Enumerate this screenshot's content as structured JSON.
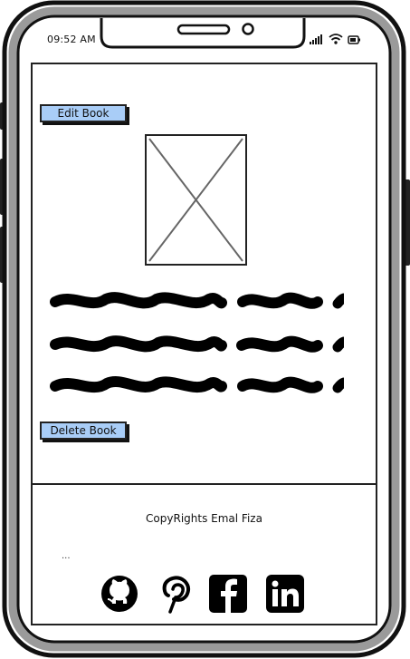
{
  "status_bar": {
    "time": "09:52 AM",
    "icons": [
      "signal-icon",
      "wifi-icon",
      "battery-icon"
    ]
  },
  "content": {
    "edit_button_label": "Edit Book",
    "delete_button_label": "Delete Book",
    "image_placeholder": "image-placeholder",
    "text_lines": 3
  },
  "footer": {
    "copyright": "CopyRights Emal Fiza",
    "ellipsis": "...",
    "social_icons": [
      "github-icon",
      "pinterest-icon",
      "facebook-icon",
      "linkedin-icon"
    ]
  },
  "colors": {
    "button_fill": "#a9cdf7",
    "outline": "#222222"
  }
}
